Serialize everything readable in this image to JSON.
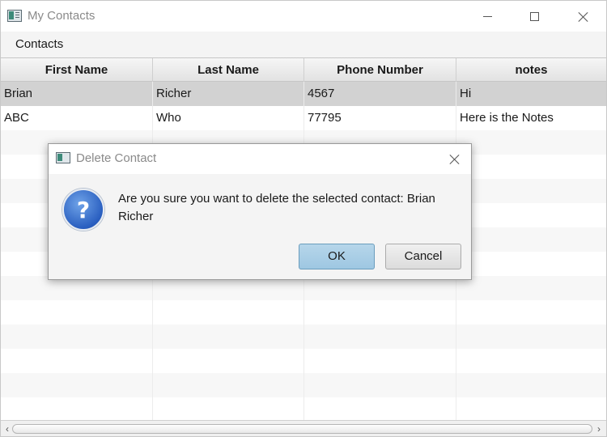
{
  "window": {
    "title": "My Contacts",
    "controls": {
      "minimize": "minimize-icon",
      "maximize": "maximize-icon",
      "close": "close-icon"
    }
  },
  "menu": {
    "items": [
      {
        "label": "Contacts"
      }
    ]
  },
  "table": {
    "columns": [
      "First Name",
      "Last Name",
      "Phone Number",
      "notes"
    ],
    "rows": [
      {
        "first": "Brian",
        "last": "Richer",
        "phone": "4567",
        "notes": "Hi",
        "selected": true
      },
      {
        "first": "ABC",
        "last": "Who",
        "phone": "77795",
        "notes": "Here is the Notes",
        "selected": false
      }
    ]
  },
  "dialog": {
    "title": "Delete Contact",
    "icon": "question-icon",
    "icon_glyph": "?",
    "message": "Are you sure you want to delete the selected contact: Brian Richer",
    "ok_label": "OK",
    "cancel_label": "Cancel"
  },
  "colors": {
    "selected_row": "#d2d2d2",
    "ok_button": "#a9cfe6",
    "question_icon": "#2a5fc0"
  }
}
